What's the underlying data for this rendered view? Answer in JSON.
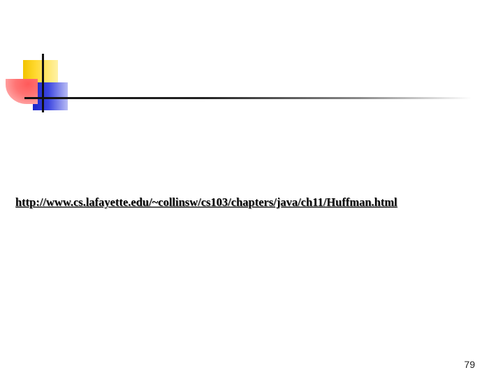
{
  "slide": {
    "url_text": "http://www.cs.lafayette.edu/~collinsw/cs103/chapters/java/ch11/Huffman.html",
    "page_number": "79"
  },
  "decoration": {
    "icon": "slide-template-logo-icon",
    "colors": {
      "yellow": "#ffd82e",
      "blue": "#3d47e0",
      "red": "#ff5a5a",
      "rule": "#111111"
    }
  }
}
